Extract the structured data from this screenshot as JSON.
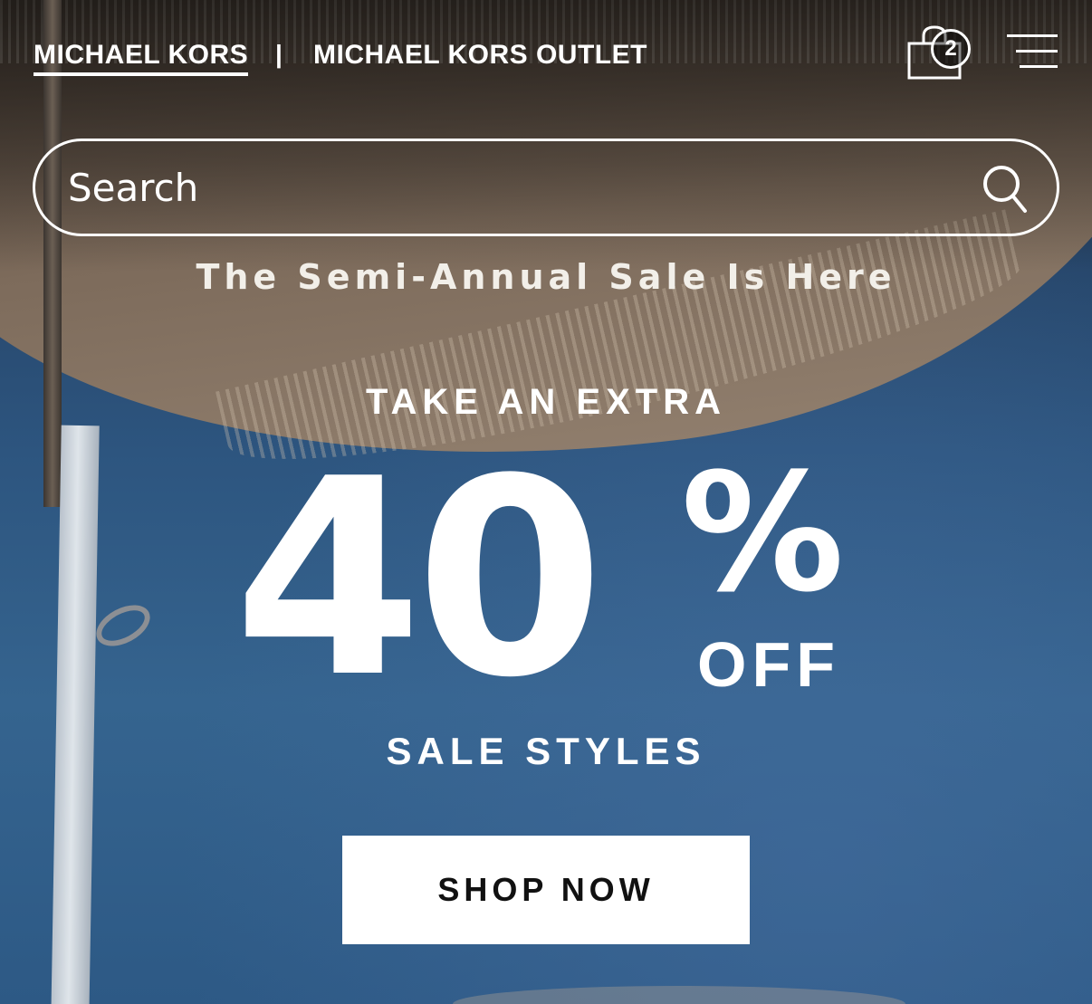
{
  "header": {
    "brand_main": "MICHAEL KORS",
    "separator": "|",
    "brand_outlet": "MICHAEL KORS OUTLET",
    "bag_count": "2",
    "icons": {
      "bag": "shopping-bag-icon",
      "menu": "hamburger-menu-icon",
      "search": "search-icon"
    }
  },
  "search": {
    "placeholder": "Search",
    "value": ""
  },
  "hero": {
    "kicker": "The Semi-Annual Sale Is Here",
    "take": "TAKE AN EXTRA",
    "number": "40",
    "percent": "%",
    "off": "OFF",
    "styles": "SALE STYLES",
    "cta": "SHOP NOW"
  },
  "colors": {
    "text": "#ffffff",
    "cta_background": "#ffffff",
    "cta_text": "#111111",
    "sky": "#2d557f"
  }
}
